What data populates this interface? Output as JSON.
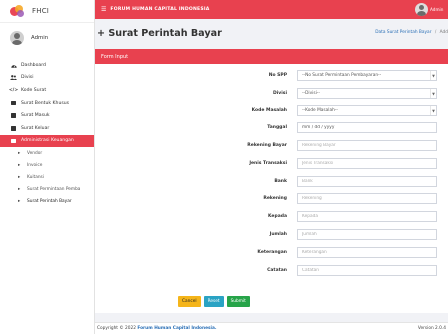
{
  "brand": {
    "name": "FHCI"
  },
  "user": {
    "name": "Admin"
  },
  "sidebar": {
    "items": [
      {
        "label": "Dashboard",
        "icon": "dashboard-icon"
      },
      {
        "label": "Divisi",
        "icon": "users-icon"
      },
      {
        "label": "Kode Surat",
        "icon": "code-icon"
      },
      {
        "label": "Surat Bentuk Khusus",
        "icon": "folder-icon"
      },
      {
        "label": "Surat Masuk",
        "icon": "folder-icon"
      },
      {
        "label": "Surat Keluar",
        "icon": "folder-icon"
      },
      {
        "label": "Administrasi Keuangan",
        "icon": "folder-icon"
      }
    ],
    "subitems": [
      {
        "label": "Vendor"
      },
      {
        "label": "Invoice"
      },
      {
        "label": "Kuitansi"
      },
      {
        "label": "Surat Permintaan Pemba"
      },
      {
        "label": "Surat Perintah Bayar"
      }
    ]
  },
  "topbar": {
    "title": "FORUM HUMAN CAPITAL INDONESIA",
    "user": "Admin"
  },
  "header": {
    "title": "+ Surat Perintah Bayar",
    "breadcrumb": [
      "Data Surat Perintah Bayar",
      "/",
      "Add"
    ]
  },
  "form": {
    "title": "Form Input",
    "fields": [
      {
        "label": "No SPP",
        "placeholder": "--No Surat Permintaan Pembayaran--"
      },
      {
        "label": "Divisi",
        "placeholder": "--Divisi--"
      },
      {
        "label": "Kode Masalah",
        "placeholder": "--Kode Masalah--"
      },
      {
        "label": "Tanggal",
        "placeholder": "mm / dd / yyyy"
      },
      {
        "label": "Rekening Bayar",
        "placeholder": "Rekening Bayar"
      },
      {
        "label": "Jenis Transaksi",
        "placeholder": "Jenis Transaksi"
      },
      {
        "label": "Bank",
        "placeholder": "Bank"
      },
      {
        "label": "Rekening",
        "placeholder": "Rekening"
      },
      {
        "label": "Kepada",
        "placeholder": "Kepada"
      },
      {
        "label": "Jumlah",
        "placeholder": "Jumlah"
      },
      {
        "label": "Keterangan",
        "placeholder": "Keterangan"
      },
      {
        "label": "Catatan",
        "placeholder": "Catatan"
      }
    ],
    "buttons": {
      "cancel": "Cancel",
      "reset": "Reset",
      "submit": "Submit"
    }
  },
  "footer": {
    "copyright": "Copyright © 2022",
    "org": "Forum Human Capital Indonesia.",
    "version": "Version 2.0.4"
  },
  "colors": {
    "accent": "#e8414f",
    "link": "#2a6fb6",
    "cancel": "#f5b51a",
    "reset": "#2aa3c4",
    "submit": "#27a449"
  }
}
